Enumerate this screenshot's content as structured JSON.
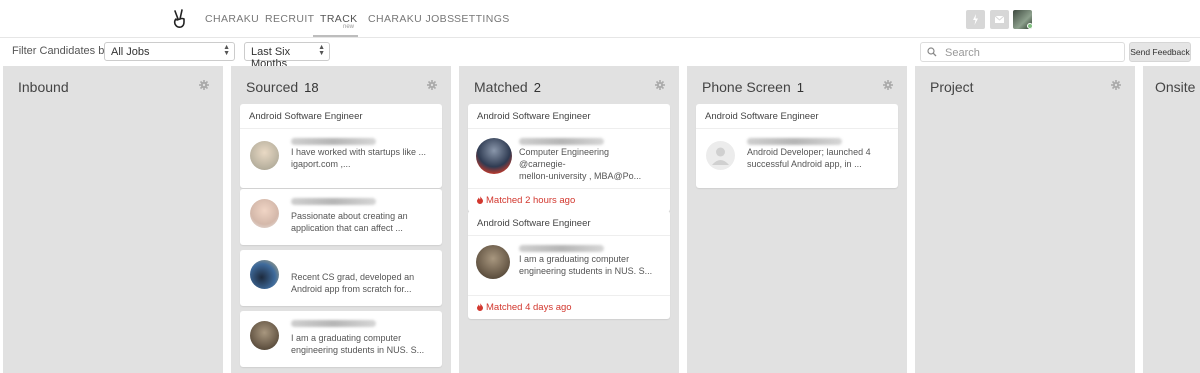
{
  "nav": {
    "items": [
      {
        "label": "CHARAKU"
      },
      {
        "label": "RECRUIT"
      },
      {
        "label": "TRACK",
        "badge": "new"
      },
      {
        "label": "CHARAKU JOBS"
      },
      {
        "label": "SETTINGS"
      }
    ],
    "right_icons": [
      "lightning-icon",
      "mail-icon",
      "user-avatar"
    ]
  },
  "filters": {
    "label": "Filter Candidates by",
    "job_select": "All Jobs",
    "period_select": "Last Six Months",
    "search_placeholder": "Search",
    "feedback_label": "Send Feedback"
  },
  "columns": [
    {
      "title": "Inbound",
      "count": "",
      "cards": []
    },
    {
      "title": "Sourced",
      "count": "18",
      "cards": [
        {
          "job": "Android Software Engineer",
          "text": "I have worked with startups like ...",
          "text2": "igaport.com ,...",
          "avatar": "#c9c3b4"
        },
        {
          "job": "",
          "text": "Passionate about creating an",
          "text2": "application that can affect ...",
          "avatar": "#c9b3a6"
        },
        {
          "job": "",
          "text": "Recent CS grad, developed an",
          "text2": "Android app from scratch for...",
          "avatar": "#33475e"
        },
        {
          "job": "",
          "text": "I am a graduating computer",
          "text2": "engineering students in NUS. S...",
          "avatar": "#6b5c4a"
        }
      ]
    },
    {
      "title": "Matched",
      "count": "2",
      "cards": [
        {
          "job": "Android Software Engineer",
          "text": "Computer Engineering @carnegie-",
          "text2": "mellon-university , MBA@Po...",
          "footer": "Matched 2 hours ago",
          "avatar": "#4f5d74"
        },
        {
          "job": "Android Software Engineer",
          "text": "I am a graduating computer",
          "text2": "engineering students in NUS. S...",
          "footer": "Matched 4 days ago",
          "avatar": "#6b5c4a"
        }
      ]
    },
    {
      "title": "Phone Screen",
      "count": "1",
      "cards": [
        {
          "job": "Android Software Engineer",
          "text": "Android Developer; launched 4",
          "text2": "successful Android app, in ...",
          "avatar": "#e6e6e6"
        }
      ]
    },
    {
      "title": "Project",
      "count": "",
      "cards": []
    },
    {
      "title": "Onsite",
      "count": "",
      "cards": []
    }
  ],
  "colors": {
    "accent_red": "#d2372e",
    "column_bg": "#e1e1e1"
  }
}
